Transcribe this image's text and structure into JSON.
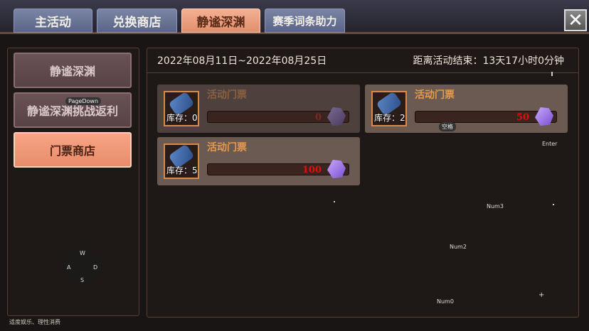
{
  "tabs": [
    {
      "label": "主活动",
      "active": false
    },
    {
      "label": "兑换商店",
      "active": false
    },
    {
      "label": "静谧深渊",
      "active": true
    },
    {
      "label": "赛季词条助力",
      "active": false
    }
  ],
  "close_icon": "close-icon",
  "sidebar": {
    "items": [
      {
        "label": "静谧深渊",
        "active": false
      },
      {
        "label": "静谧深渊挑战返利",
        "active": false
      },
      {
        "label": "门票商店",
        "active": true
      }
    ]
  },
  "event": {
    "date_range": "2022年08月11日~2022年08月25日",
    "countdown": "距离活动结束：13天17小时0分钟"
  },
  "cards": [
    {
      "name": "活动门票",
      "stock": "库存：0",
      "price": "0",
      "dim": true
    },
    {
      "name": "活动门票",
      "stock": "库存：2",
      "price": "50",
      "dim": false
    },
    {
      "name": "活动门票",
      "stock": "库存：5",
      "price": "100",
      "dim": false
    }
  ],
  "key_hints": {
    "pagedown": "PageDown",
    "space": "空格",
    "enter": "Enter",
    "num3": "Num3",
    "num2": "Num2",
    "num0": "Num0",
    "w": "W",
    "a": "A",
    "s": "S",
    "d": "D"
  },
  "footer_text": "适度娱乐、理性消费",
  "colors": {
    "accent": "#e98c6a",
    "price_red": "#e01010",
    "item_name": "#e69a4c"
  }
}
